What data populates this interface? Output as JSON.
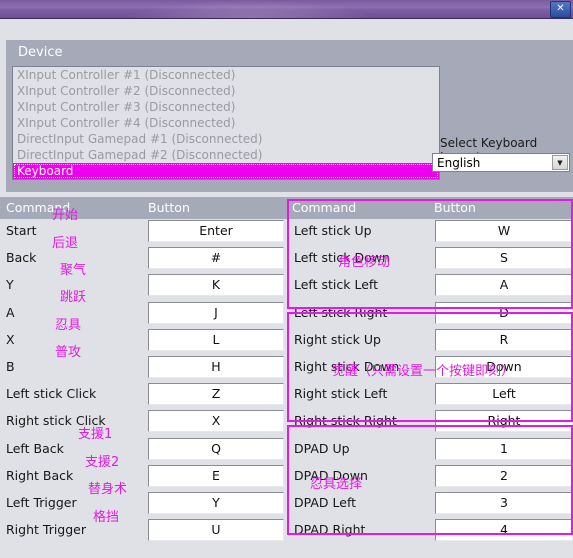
{
  "window": {
    "close_label": "✕"
  },
  "device": {
    "group_label": "Device",
    "items": [
      {
        "label": "XInput Controller #1 (Disconnected)",
        "selected": false
      },
      {
        "label": "XInput Controller #2 (Disconnected)",
        "selected": false
      },
      {
        "label": "XInput Controller #3 (Disconnected)",
        "selected": false
      },
      {
        "label": "XInput Controller #4 (Disconnected)",
        "selected": false
      },
      {
        "label": "DirectInput Gamepad #1 (Disconnected)",
        "selected": false
      },
      {
        "label": "DirectInput Gamepad #2 (Disconnected)",
        "selected": false
      },
      {
        "label": "Keyboard",
        "selected": true
      }
    ]
  },
  "keyboard_layout": {
    "label": "Select Keyboard Layout",
    "value": "English",
    "arrow_icon": "chevron-down-icon"
  },
  "headers": {
    "left_command": "Command",
    "left_button": "Button",
    "right_command": "Command",
    "right_button": "Button"
  },
  "left_rows": [
    {
      "command": "Start",
      "button": "Enter"
    },
    {
      "command": "Back",
      "button": "#"
    },
    {
      "command": "Y",
      "button": "K"
    },
    {
      "command": "A",
      "button": "J"
    },
    {
      "command": "X",
      "button": "L"
    },
    {
      "command": "B",
      "button": "H"
    },
    {
      "command": "Left stick Click",
      "button": "Z"
    },
    {
      "command": "Right stick Click",
      "button": "X"
    },
    {
      "command": "Left Back",
      "button": "Q"
    },
    {
      "command": "Right Back",
      "button": "E"
    },
    {
      "command": "Left Trigger",
      "button": "Y"
    },
    {
      "command": "Right Trigger",
      "button": "U"
    }
  ],
  "right_rows": [
    {
      "command": "Left stick Up",
      "button": "W"
    },
    {
      "command": "Left stick Down",
      "button": "S"
    },
    {
      "command": "Left stick Left",
      "button": "A"
    },
    {
      "command": "Left stick Right",
      "button": "D"
    },
    {
      "command": "Right stick Up",
      "button": "R"
    },
    {
      "command": "Right stick Down",
      "button": "Down"
    },
    {
      "command": "Right stick Left",
      "button": "Left"
    },
    {
      "command": "Right stick Right",
      "button": "Right"
    },
    {
      "command": "DPAD Up",
      "button": "1"
    },
    {
      "command": "DPAD Down",
      "button": "2"
    },
    {
      "command": "DPAD Left",
      "button": "3"
    },
    {
      "command": "DPAD Right",
      "button": "4"
    }
  ],
  "annotations": {
    "left_labels": [
      "开始",
      "后退",
      "聚气",
      "跳跃",
      "忍具",
      "普攻",
      "支援1",
      "支援2",
      "替身术",
      "格挡"
    ],
    "right_group_1": "角色移动",
    "right_group_2": "觉醒（只需设置一个按键即刻）",
    "right_group_3": "忍具选择"
  },
  "colors": {
    "annotation": "#e519e5",
    "selection": "#ee00ee",
    "header_band": "#a6aab8",
    "titlebar": "#7d5da3"
  }
}
